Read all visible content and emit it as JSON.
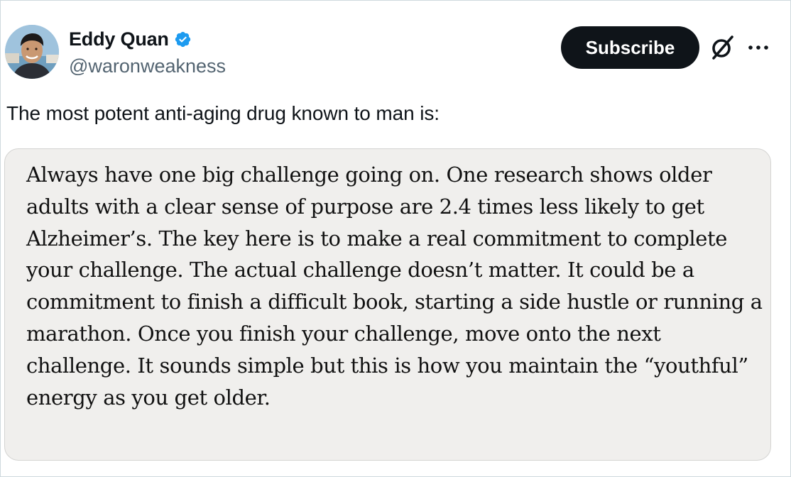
{
  "post": {
    "author": {
      "display_name": "Eddy Quan",
      "handle": "@waronweakness",
      "verified": true
    },
    "subscribe_label": "Subscribe",
    "text": "The most potent anti-aging drug known to man is:",
    "quote_image_text": "Always have one big challenge going on. One research shows older adults with a clear sense of purpose are 2.4 times less likely to get Alzheimer’s. The key here is to make a real commitment to complete your challenge. The actual challenge doesn’t matter. It could be a commitment to finish a difficult book, starting a side hustle or running a marathon. Once you finish your challenge, move onto the next challenge. It sounds simple but this is how you maintain the “youthful” energy as you get older."
  },
  "icons": {
    "verified": "verified-badge-icon",
    "grok": "grok-icon",
    "more": "more-icon"
  },
  "colors": {
    "verified_blue": "#1d9bf0",
    "button_bg": "#0f1419",
    "handle_gray": "#536471",
    "card_bg": "#f0efed"
  }
}
